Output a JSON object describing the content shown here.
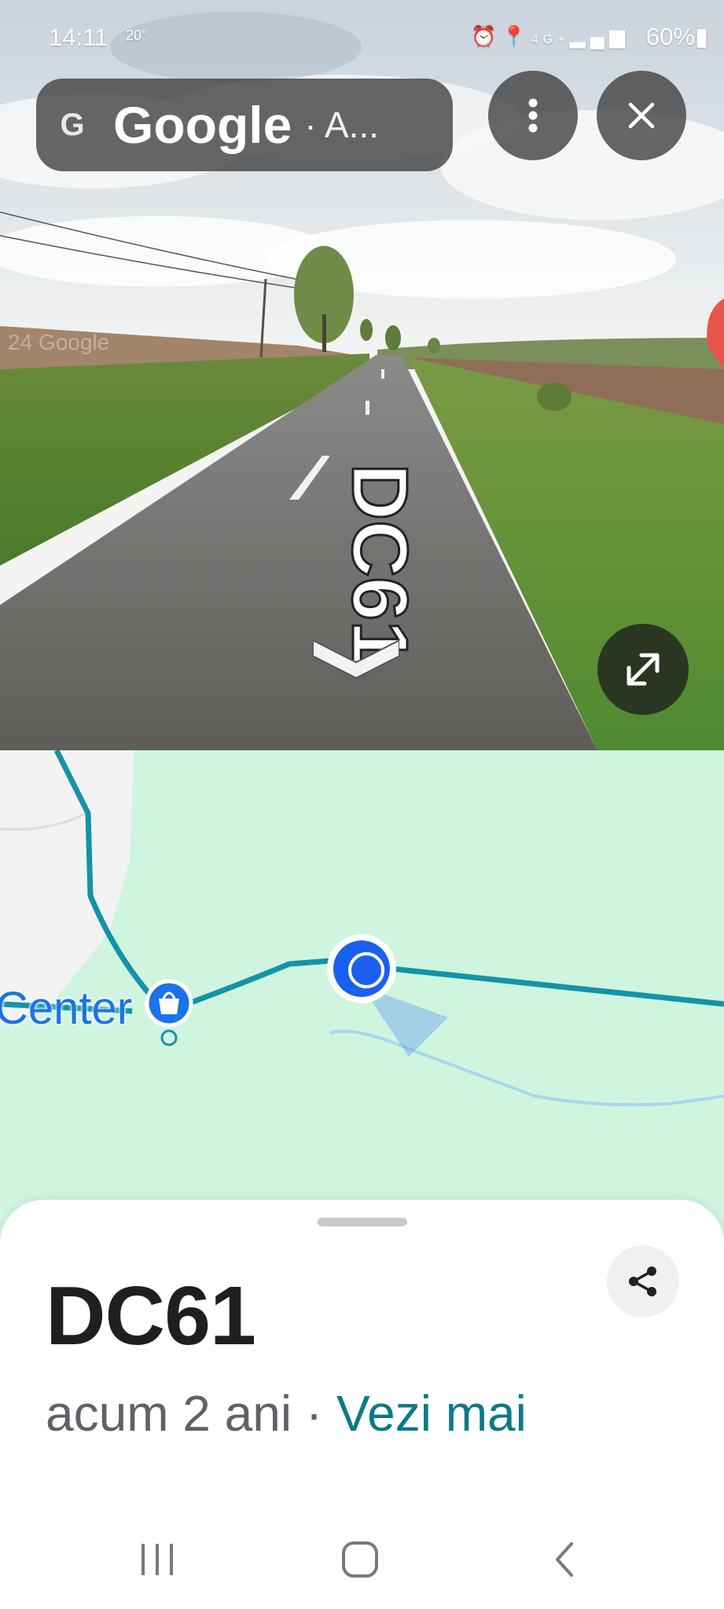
{
  "status_bar": {
    "time": "14:11",
    "temperature": "20°",
    "icons": [
      "alarm-icon",
      "location-icon",
      "4g-icon",
      "signal-icon"
    ],
    "battery": "60%"
  },
  "search": {
    "icon": "google-g-icon",
    "brand": "Google",
    "subtitle": "· A..."
  },
  "toolbar": {
    "more_icon": "more-vertical-icon",
    "close_icon": "close-icon"
  },
  "street_view": {
    "road_label": "DC61",
    "expand_icon": "expand-icon"
  },
  "map": {
    "poi_label": "Center",
    "poi_icon": "shopping-bag-icon"
  },
  "place": {
    "title": "DC61",
    "age": "acum 2 ani",
    "separator": " · ",
    "see_more": "Vezi mai"
  },
  "colors": {
    "map_background": "#cff5df",
    "route": "#1493a8",
    "location_dot": "#1a5ff0",
    "link": "#0b7a84"
  },
  "navigation": {
    "icons": [
      "recent-apps-icon",
      "home-icon",
      "back-icon"
    ]
  }
}
